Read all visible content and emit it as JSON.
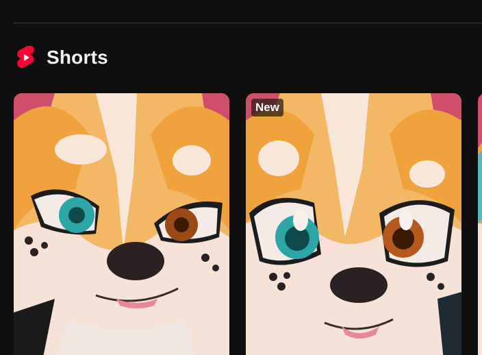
{
  "shelf": {
    "title": "Shorts",
    "icon": "youtube-shorts-icon",
    "accent_color": "#ff0033"
  },
  "cards": [
    {
      "badge": "",
      "thumbnail": "orange-white-corgi-character-smirking"
    },
    {
      "badge": "New",
      "thumbnail": "orange-white-corgi-character-smiling"
    },
    {
      "badge": "",
      "thumbnail": "partially-visible-thumbnail"
    }
  ]
}
